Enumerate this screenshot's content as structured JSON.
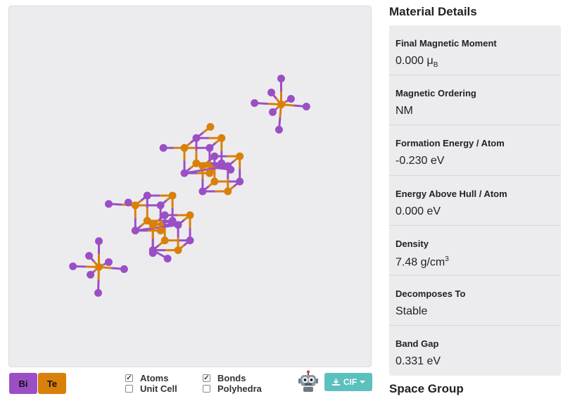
{
  "legend": {
    "elements": [
      {
        "symbol": "Bi",
        "color": "#9b4fc4"
      },
      {
        "symbol": "Te",
        "color": "#d9800a"
      }
    ]
  },
  "toggles": [
    {
      "label": "Atoms",
      "checked": true
    },
    {
      "label": "Unit Cell",
      "checked": false
    },
    {
      "label": "Bonds",
      "checked": true
    },
    {
      "label": "Polyhedra",
      "checked": false
    }
  ],
  "toolbar": {
    "robot_icon": "robot-icon",
    "download_label": "CIF",
    "download_icon": "download-icon",
    "caret_icon": "caret-down-icon"
  },
  "panel": {
    "title": "Material Details",
    "details": [
      {
        "label": "Final Magnetic Moment",
        "value": "0.000 μ",
        "sub": "B",
        "sup": ""
      },
      {
        "label": "Magnetic Ordering",
        "value": "NM",
        "sub": "",
        "sup": ""
      },
      {
        "label": "Formation Energy / Atom",
        "value": "-0.230 eV",
        "sub": "",
        "sup": ""
      },
      {
        "label": "Energy Above Hull / Atom",
        "value": "0.000 eV",
        "sub": "",
        "sup": ""
      },
      {
        "label": "Density",
        "value": "7.48 g/cm",
        "sub": "",
        "sup": "3"
      },
      {
        "label": "Decomposes To",
        "value": "Stable",
        "sub": "",
        "sup": ""
      },
      {
        "label": "Band Gap",
        "value": "0.331 eV",
        "sub": "",
        "sup": ""
      }
    ],
    "next_section": "Space Group"
  },
  "colors": {
    "bi": "#9b4fc4",
    "te": "#d9800a",
    "viewer_bg": "#ececef",
    "accent": "#5bc0be"
  }
}
